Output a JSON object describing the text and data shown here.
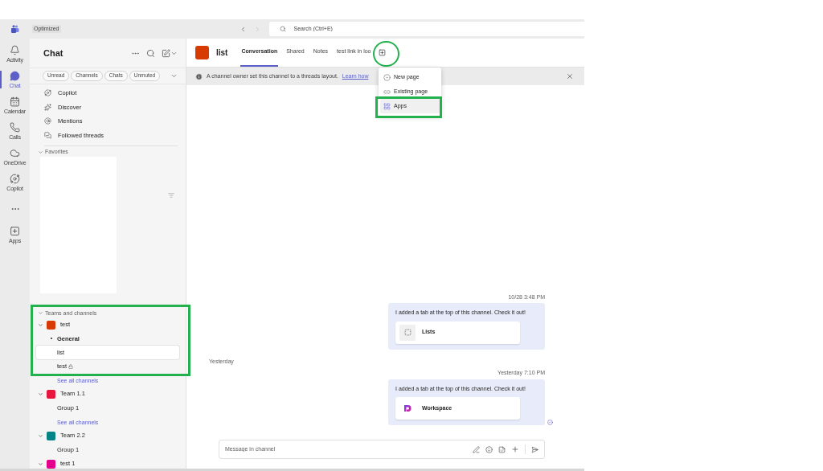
{
  "title_bar": {
    "badge": "Optimized",
    "search_placeholder": "Search (Ctrl+E)"
  },
  "rail": [
    {
      "kind": "activity",
      "label": "Activity",
      "selected": false
    },
    {
      "kind": "chat",
      "label": "Chat",
      "selected": true
    },
    {
      "kind": "calendar",
      "label": "Calendar",
      "selected": false
    },
    {
      "kind": "calls",
      "label": "Calls",
      "selected": false
    },
    {
      "kind": "onedrive",
      "label": "OneDrive",
      "selected": false
    },
    {
      "kind": "copilot",
      "label": "Copilot",
      "selected": false
    },
    {
      "kind": "more",
      "selected": false
    },
    {
      "kind": "apps",
      "label": "Apps",
      "selected": false
    }
  ],
  "sidebar": {
    "title": "Chat",
    "filters": [
      "Unread",
      "Channels",
      "Chats",
      "Unmuted"
    ],
    "links": [
      {
        "kind": "copilot",
        "label": "Copilot"
      },
      {
        "kind": "discover",
        "label": "Discover"
      },
      {
        "kind": "mentions",
        "label": "Mentions"
      },
      {
        "kind": "followed",
        "label": "Followed threads"
      }
    ],
    "favorites_header": "Favorites",
    "teams_header": "Teams and channels",
    "teams": [
      {
        "name": "test",
        "color": "#d83b01",
        "channels": [
          {
            "name": "General",
            "unread": true,
            "selected": false,
            "private": false
          },
          {
            "name": "list",
            "unread": false,
            "selected": true,
            "private": false
          },
          {
            "name": "test",
            "unread": false,
            "selected": false,
            "private": true
          }
        ],
        "see_all": "See all channels"
      },
      {
        "name": "Team 1.1",
        "color": "#e8173d",
        "channels": [
          {
            "name": "Group 1",
            "unread": false,
            "selected": false,
            "private": false
          }
        ],
        "see_all": "See all channels"
      },
      {
        "name": "Team 2.2",
        "color": "#038387",
        "channels": [
          {
            "name": "Group 1",
            "unread": false,
            "selected": false,
            "private": false
          }
        ]
      },
      {
        "name": "test 1",
        "color": "#e3008c"
      }
    ]
  },
  "channel": {
    "title": "list",
    "tabs": [
      {
        "label": "Conversation",
        "selected": true
      },
      {
        "label": "Shared",
        "selected": false
      },
      {
        "label": "Notes",
        "selected": false
      },
      {
        "label": "test link in loo",
        "selected": false
      }
    ]
  },
  "notice": {
    "text": "A channel owner set this channel to a threads layout.",
    "link": "Learn how"
  },
  "add_tab_menu": [
    {
      "kind": "loop",
      "label": "New page",
      "selected": false
    },
    {
      "kind": "link",
      "label": "Existing page",
      "selected": false
    },
    {
      "kind": "apps",
      "label": "Apps",
      "selected": true
    }
  ],
  "messages": [
    {
      "kind": "message",
      "timestamp": "10/28 3:48 PM",
      "text": "I added a tab at the top of this channel. Check it out!",
      "card": {
        "kind": "lists",
        "label": "Lists"
      },
      "seen": false
    },
    {
      "kind": "divider",
      "text": "Yesterday"
    },
    {
      "kind": "message",
      "timestamp": "Yesterday 7:10 PM",
      "text": "I added a tab at the top of this channel. Check it out!",
      "card": {
        "kind": "workspace",
        "label": "Workspace"
      },
      "seen": true
    }
  ],
  "composer": {
    "placeholder": "Message in channel"
  }
}
